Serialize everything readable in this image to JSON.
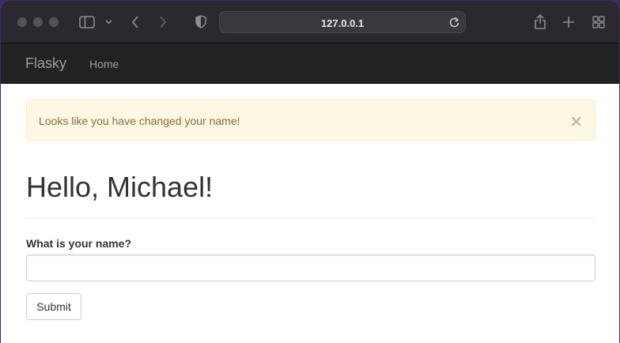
{
  "browser": {
    "address": "127.0.0.1",
    "icons": [
      "sidebar-icon",
      "chevron-down-icon",
      "back-icon",
      "forward-icon",
      "privacy-shield-icon",
      "reload-icon",
      "share-icon",
      "new-tab-icon",
      "tab-overview-icon"
    ]
  },
  "navbar": {
    "brand": "Flasky",
    "links": [
      {
        "label": "Home"
      }
    ]
  },
  "alert": {
    "message": "Looks like you have changed your name!",
    "close": "×"
  },
  "page": {
    "heading": "Hello, Michael!"
  },
  "form": {
    "label": "What is your name?",
    "input_value": "",
    "submit_label": "Submit"
  },
  "colors": {
    "navbar_bg": "#222222",
    "alert_bg": "#fcf8e3",
    "alert_text": "#8a6d3b"
  }
}
